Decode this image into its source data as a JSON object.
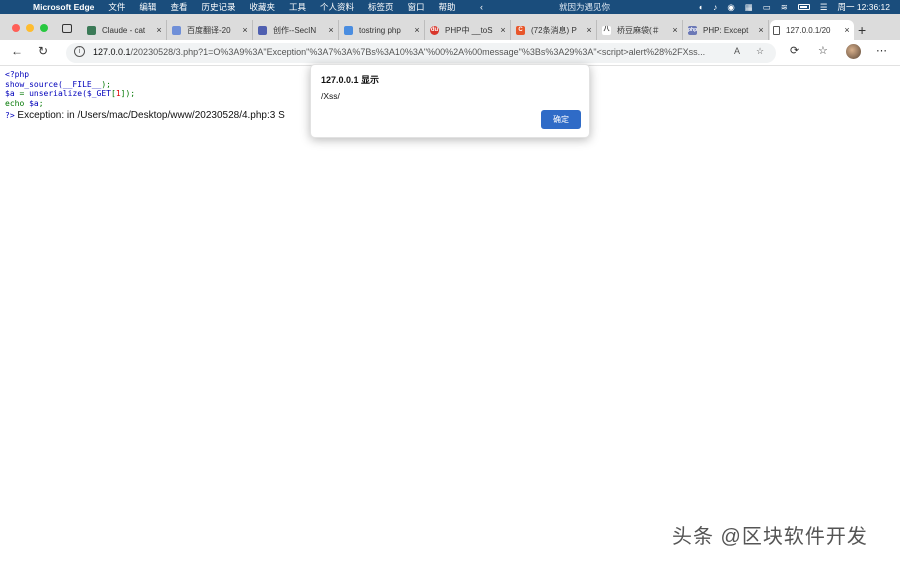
{
  "menubar": {
    "app_name": "Microsoft Edge",
    "items": [
      "文件",
      "编辑",
      "查看",
      "历史记录",
      "收藏夹",
      "工具",
      "个人资料",
      "标签页",
      "窗口",
      "帮助"
    ],
    "now_playing": "就因为遇见你",
    "clock": "周一 12:36:12"
  },
  "tabs": [
    {
      "label": "Claude - cat",
      "favicon_color": "#3b7a57",
      "favicon_glyph": ""
    },
    {
      "label": "百度翻译-20",
      "favicon_color": "#6f8fd8",
      "favicon_glyph": ""
    },
    {
      "label": "创作--SecIN",
      "favicon_color": "#4f5fb0",
      "favicon_glyph": ""
    },
    {
      "label": "tostring php",
      "favicon_color": "#4a8de0",
      "favicon_glyph": ""
    },
    {
      "label": "PHP中 __toS",
      "favicon_color": "#d9362b",
      "favicon_glyph": "du"
    },
    {
      "label": "(72条消息) P",
      "favicon_color": "#e8562a",
      "favicon_glyph": "C"
    },
    {
      "label": "桥豆麻袋(＃",
      "favicon_color": "#ffffff",
      "favicon_glyph": "八"
    },
    {
      "label": "PHP: Except",
      "favicon_color": "#6b78b6",
      "favicon_glyph": "php"
    },
    {
      "label": "127.0.0.1/20",
      "favicon_color": "#ffffff",
      "favicon_glyph": "",
      "active": true
    }
  ],
  "address": {
    "host": "127.0.0.1",
    "path": "/20230528/3.php?1=O%3A9%3A\"Exception\"%3A7%3A%7Bs%3A10%3A\"%00%2A%00message\"%3Bs%3A29%3A\"<script>alert%28%2FXss..."
  },
  "source_lines": [
    [
      {
        "t": "<?php",
        "c": "c-blue"
      }
    ],
    [
      {
        "t": "show_source(",
        "c": "c-blue"
      },
      {
        "t": "__FILE__",
        "c": "c-blue"
      },
      {
        "t": ");",
        "c": "c-green"
      }
    ],
    [
      {
        "t": "$a ",
        "c": "c-blue"
      },
      {
        "t": "= ",
        "c": "c-green"
      },
      {
        "t": "unserialize(",
        "c": "c-blue"
      },
      {
        "t": "$_GET",
        "c": "c-blue"
      },
      {
        "t": "[",
        "c": "c-green"
      },
      {
        "t": "1",
        "c": "c-red"
      },
      {
        "t": "]);",
        "c": "c-green"
      }
    ],
    [
      {
        "t": "echo ",
        "c": "c-green"
      },
      {
        "t": "$a",
        "c": "c-blue"
      },
      {
        "t": ";",
        "c": "c-green"
      }
    ]
  ],
  "output": {
    "php_close": "?>",
    "text": " Exception: in /Users/mac/Desktop/www/20230528/4.php:3 S"
  },
  "dialog": {
    "title": "127.0.0.1 显示",
    "message": "/Xss/",
    "ok_label": "确定"
  },
  "watermark": "头条 @区块软件开发"
}
